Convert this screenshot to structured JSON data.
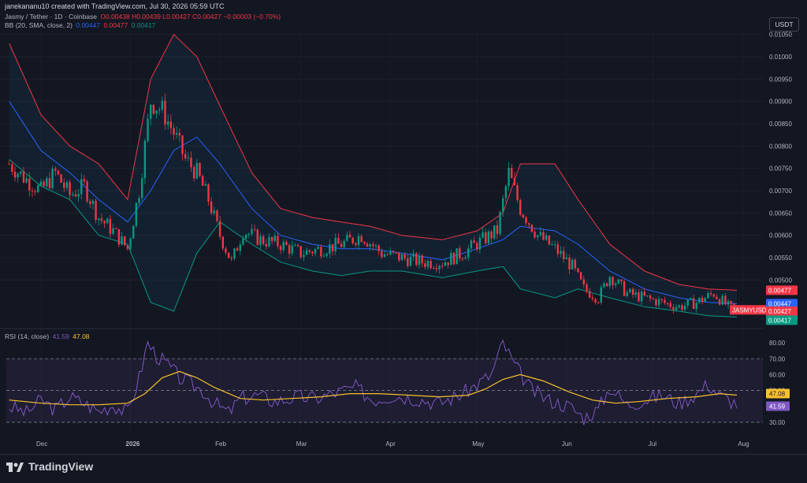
{
  "header": {
    "creator_line": "janekananu10 created with TradingView.com, Jul 30, 2026 05:59 UTC",
    "symbol_label": "Jasmy / Tether · 1D · Coinbase",
    "ohlc": "O0.00438 H0.00439 L0.00427 C0.00427 −0.00003 (−0.70%)",
    "bb_label": "BB (20, SMA, close, 2)",
    "bb_basis": "0.00447",
    "bb_upper": "0.00477",
    "bb_lower": "0.00417",
    "currency_button": "USDT"
  },
  "rsi_legend": {
    "label": "RSI (14, close)",
    "rsi": "41.59",
    "ma": "47.08"
  },
  "footer": {
    "brand": "TradingView"
  },
  "colors": {
    "up": "#089981",
    "down": "#f23645",
    "basis": "#2962ff",
    "upper": "#f23645",
    "lower": "#089981",
    "rsi": "#7e57c2",
    "rsi_ma": "#f7c12b"
  },
  "chart_data": [
    {
      "type": "candlestick",
      "title": "",
      "ylim": [
        0.004,
        0.0106
      ],
      "y_ticks": [
        "0.01050",
        "0.01000",
        "0.00950",
        "0.00900",
        "0.00850",
        "0.00800",
        "0.00750",
        "0.00700",
        "0.00650",
        "0.00600",
        "0.00550",
        "0.00500"
      ],
      "x_ticks": [
        "Dec",
        "2026",
        "Feb",
        "Mar",
        "Apr",
        "May",
        "Jun",
        "Jul",
        "Aug"
      ],
      "price_tags": [
        {
          "label": "0.00477",
          "color": "#f23645",
          "value": 0.00477
        },
        {
          "label": "0.00447",
          "color": "#2962ff",
          "value": 0.00447
        },
        {
          "label": "JASMYUSDT",
          "color": "#f23645",
          "value": 0.00433
        },
        {
          "label": "0.00427",
          "color": "#f23645",
          "value": 0.0043
        },
        {
          "label": "0.00417",
          "color": "#089981",
          "value": 0.0041
        }
      ],
      "close_path": [
        [
          "2025-11-20",
          0.0076
        ],
        [
          "2025-11-25",
          0.0073
        ],
        [
          "2025-12-01",
          0.007
        ],
        [
          "2025-12-06",
          0.0074
        ],
        [
          "2025-12-11",
          0.0069
        ],
        [
          "2025-12-16",
          0.0071
        ],
        [
          "2025-12-21",
          0.0064
        ],
        [
          "2025-12-26",
          0.0061
        ],
        [
          "2025-12-31",
          0.0057
        ],
        [
          "2026-01-04",
          0.007
        ],
        [
          "2026-01-08",
          0.009
        ],
        [
          "2026-01-12",
          0.0088
        ],
        [
          "2026-01-16",
          0.0083
        ],
        [
          "2026-01-20",
          0.0077
        ],
        [
          "2026-01-24",
          0.0074
        ],
        [
          "2026-01-28",
          0.0068
        ],
        [
          "2026-02-01",
          0.006
        ],
        [
          "2026-02-05",
          0.0054
        ],
        [
          "2026-02-09",
          0.0061
        ],
        [
          "2026-02-15",
          0.0059
        ],
        [
          "2026-02-22",
          0.0058
        ],
        [
          "2026-03-01",
          0.0056
        ],
        [
          "2026-03-08",
          0.0057
        ],
        [
          "2026-03-15",
          0.0058
        ],
        [
          "2026-03-22",
          0.006
        ],
        [
          "2026-03-29",
          0.0056
        ],
        [
          "2026-04-05",
          0.0055
        ],
        [
          "2026-04-12",
          0.0054
        ],
        [
          "2026-04-19",
          0.0054
        ],
        [
          "2026-04-26",
          0.0056
        ],
        [
          "2026-05-03",
          0.0059
        ],
        [
          "2026-05-08",
          0.0061
        ],
        [
          "2026-05-12",
          0.0074
        ],
        [
          "2026-05-16",
          0.0066
        ],
        [
          "2026-05-22",
          0.006
        ],
        [
          "2026-05-28",
          0.0057
        ],
        [
          "2026-06-03",
          0.0053
        ],
        [
          "2026-06-07",
          0.0048
        ],
        [
          "2026-06-12",
          0.0046
        ],
        [
          "2026-06-16",
          0.0051
        ],
        [
          "2026-06-22",
          0.0047
        ],
        [
          "2026-06-28",
          0.0046
        ],
        [
          "2026-07-04",
          0.0045
        ],
        [
          "2026-07-10",
          0.0044
        ],
        [
          "2026-07-16",
          0.0045
        ],
        [
          "2026-07-22",
          0.0047
        ],
        [
          "2026-07-27",
          0.0044
        ],
        [
          "2026-07-30",
          0.00427
        ]
      ],
      "bb_upper": [
        [
          "2025-11-20",
          0.0103
        ],
        [
          "2025-12-01",
          0.0087
        ],
        [
          "2025-12-11",
          0.008
        ],
        [
          "2025-12-21",
          0.0076
        ],
        [
          "2025-12-31",
          0.0068
        ],
        [
          "2026-01-08",
          0.0095
        ],
        [
          "2026-01-16",
          0.0105
        ],
        [
          "2026-01-24",
          0.01
        ],
        [
          "2026-02-01",
          0.0089
        ],
        [
          "2026-02-12",
          0.0074
        ],
        [
          "2026-02-22",
          0.0066
        ],
        [
          "2026-03-05",
          0.0064
        ],
        [
          "2026-03-15",
          0.0063
        ],
        [
          "2026-03-25",
          0.0062
        ],
        [
          "2026-04-05",
          0.006
        ],
        [
          "2026-04-19",
          0.0059
        ],
        [
          "2026-05-01",
          0.0061
        ],
        [
          "2026-05-10",
          0.0065
        ],
        [
          "2026-05-16",
          0.0076
        ],
        [
          "2026-05-28",
          0.0076
        ],
        [
          "2026-06-05",
          0.0068
        ],
        [
          "2026-06-16",
          0.0058
        ],
        [
          "2026-06-28",
          0.0052
        ],
        [
          "2026-07-10",
          0.0049
        ],
        [
          "2026-07-20",
          0.0048
        ],
        [
          "2026-07-30",
          0.00477
        ]
      ],
      "bb_basis": [
        [
          "2025-11-20",
          0.009
        ],
        [
          "2025-12-01",
          0.0079
        ],
        [
          "2025-12-11",
          0.0074
        ],
        [
          "2025-12-21",
          0.0068
        ],
        [
          "2025-12-31",
          0.0063
        ],
        [
          "2026-01-08",
          0.007
        ],
        [
          "2026-01-16",
          0.0079
        ],
        [
          "2026-01-24",
          0.0082
        ],
        [
          "2026-02-01",
          0.0076
        ],
        [
          "2026-02-12",
          0.0066
        ],
        [
          "2026-02-22",
          0.006
        ],
        [
          "2026-03-05",
          0.0058
        ],
        [
          "2026-03-15",
          0.0057
        ],
        [
          "2026-03-25",
          0.0057
        ],
        [
          "2026-04-05",
          0.0056
        ],
        [
          "2026-04-19",
          0.00545
        ],
        [
          "2026-05-01",
          0.0057
        ],
        [
          "2026-05-10",
          0.0059
        ],
        [
          "2026-05-16",
          0.0062
        ],
        [
          "2026-05-28",
          0.0061
        ],
        [
          "2026-06-05",
          0.0058
        ],
        [
          "2026-06-16",
          0.0052
        ],
        [
          "2026-06-28",
          0.0048
        ],
        [
          "2026-07-10",
          0.0046
        ],
        [
          "2026-07-20",
          0.0045
        ],
        [
          "2026-07-30",
          0.00447
        ]
      ],
      "bb_lower": [
        [
          "2025-11-20",
          0.0077
        ],
        [
          "2025-12-01",
          0.0071
        ],
        [
          "2025-12-11",
          0.0068
        ],
        [
          "2025-12-21",
          0.006
        ],
        [
          "2025-12-31",
          0.0058
        ],
        [
          "2026-01-08",
          0.0045
        ],
        [
          "2026-01-16",
          0.0043
        ],
        [
          "2026-01-24",
          0.0056
        ],
        [
          "2026-02-01",
          0.0063
        ],
        [
          "2026-02-12",
          0.0058
        ],
        [
          "2026-02-22",
          0.0054
        ],
        [
          "2026-03-05",
          0.0052
        ],
        [
          "2026-03-15",
          0.0051
        ],
        [
          "2026-03-25",
          0.0052
        ],
        [
          "2026-04-05",
          0.0052
        ],
        [
          "2026-04-19",
          0.00505
        ],
        [
          "2026-05-01",
          0.0052
        ],
        [
          "2026-05-10",
          0.0053
        ],
        [
          "2026-05-16",
          0.0048
        ],
        [
          "2026-05-28",
          0.0046
        ],
        [
          "2026-06-05",
          0.0048
        ],
        [
          "2026-06-16",
          0.0046
        ],
        [
          "2026-06-28",
          0.0044
        ],
        [
          "2026-07-10",
          0.0043
        ],
        [
          "2026-07-20",
          0.0042
        ],
        [
          "2026-07-30",
          0.00417
        ]
      ]
    },
    {
      "type": "line",
      "title": "",
      "ylim": [
        25,
        85
      ],
      "y_ticks": [
        "80.00",
        "70.00",
        "60.00",
        "50.00",
        "40.00",
        "30.00"
      ],
      "levels": [
        70,
        50,
        30
      ],
      "series": [
        {
          "name": "RSI",
          "values": [
            [
              "2025-11-20",
              40
            ],
            [
              "2025-11-26",
              36
            ],
            [
              "2025-12-01",
              44
            ],
            [
              "2025-12-06",
              38
            ],
            [
              "2025-12-11",
              46
            ],
            [
              "2025-12-16",
              42
            ],
            [
              "2025-12-21",
              37
            ],
            [
              "2025-12-26",
              41
            ],
            [
              "2025-12-31",
              36
            ],
            [
              "2026-01-04",
              58
            ],
            [
              "2026-01-07",
              80
            ],
            [
              "2026-01-10",
              72
            ],
            [
              "2026-01-14",
              66
            ],
            [
              "2026-01-18",
              58
            ],
            [
              "2026-01-22",
              54
            ],
            [
              "2026-01-26",
              50
            ],
            [
              "2026-01-30",
              42
            ],
            [
              "2026-02-04",
              36
            ],
            [
              "2026-02-08",
              45
            ],
            [
              "2026-02-14",
              47
            ],
            [
              "2026-02-20",
              43
            ],
            [
              "2026-02-28",
              46
            ],
            [
              "2026-03-06",
              45
            ],
            [
              "2026-03-14",
              49
            ],
            [
              "2026-03-20",
              52
            ],
            [
              "2026-03-26",
              44
            ],
            [
              "2026-04-02",
              47
            ],
            [
              "2026-04-10",
              45
            ],
            [
              "2026-04-18",
              42
            ],
            [
              "2026-04-26",
              48
            ],
            [
              "2026-05-02",
              55
            ],
            [
              "2026-05-06",
              60
            ],
            [
              "2026-05-10",
              80
            ],
            [
              "2026-05-14",
              66
            ],
            [
              "2026-05-20",
              50
            ],
            [
              "2026-05-26",
              44
            ],
            [
              "2026-06-02",
              40
            ],
            [
              "2026-06-07",
              33
            ],
            [
              "2026-06-12",
              38
            ],
            [
              "2026-06-16",
              52
            ],
            [
              "2026-06-22",
              41
            ],
            [
              "2026-06-28",
              44
            ],
            [
              "2026-07-04",
              47
            ],
            [
              "2026-07-10",
              42
            ],
            [
              "2026-07-16",
              48
            ],
            [
              "2026-07-20",
              54
            ],
            [
              "2026-07-24",
              47
            ],
            [
              "2026-07-30",
              41.59
            ]
          ]
        },
        {
          "name": "RSI-based MA",
          "values": [
            [
              "2025-11-20",
              44
            ],
            [
              "2025-12-01",
              42
            ],
            [
              "2025-12-11",
              41
            ],
            [
              "2025-12-21",
              41
            ],
            [
              "2025-12-31",
              42
            ],
            [
              "2026-01-06",
              48
            ],
            [
              "2026-01-12",
              58
            ],
            [
              "2026-01-18",
              62
            ],
            [
              "2026-01-24",
              58
            ],
            [
              "2026-01-30",
              52
            ],
            [
              "2026-02-08",
              45
            ],
            [
              "2026-02-16",
              44
            ],
            [
              "2026-02-26",
              45
            ],
            [
              "2026-03-08",
              46
            ],
            [
              "2026-03-18",
              48
            ],
            [
              "2026-03-28",
              48
            ],
            [
              "2026-04-08",
              47
            ],
            [
              "2026-04-18",
              46
            ],
            [
              "2026-04-28",
              47
            ],
            [
              "2026-05-04",
              51
            ],
            [
              "2026-05-10",
              57
            ],
            [
              "2026-05-16",
              60
            ],
            [
              "2026-05-24",
              56
            ],
            [
              "2026-06-02",
              49
            ],
            [
              "2026-06-10",
              44
            ],
            [
              "2026-06-18",
              42
            ],
            [
              "2026-06-26",
              43
            ],
            [
              "2026-07-06",
              45
            ],
            [
              "2026-07-16",
              46
            ],
            [
              "2026-07-24",
              48
            ],
            [
              "2026-07-30",
              47.08
            ]
          ]
        }
      ],
      "price_tags": [
        {
          "label": "47.08",
          "color": "#f7c12b",
          "value": 47.08
        },
        {
          "label": "41.59",
          "color": "#7e57c2",
          "value": 41.59
        }
      ]
    }
  ]
}
